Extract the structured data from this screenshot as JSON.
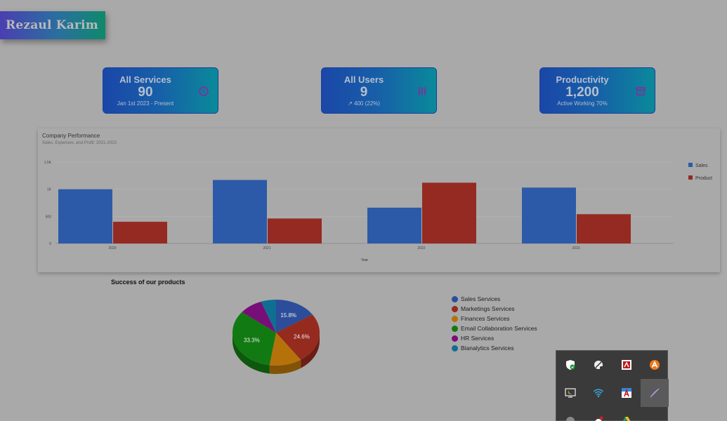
{
  "brand": {
    "name": "Rezaul Karim"
  },
  "cards": [
    {
      "title": "All Services",
      "value": "90",
      "sub": "Jan 1st 2023 - Present",
      "icon": "clock-icon"
    },
    {
      "title": "All Users",
      "value": "9",
      "sub": "↗ 400 (22%)",
      "icon": "sliders-icon"
    },
    {
      "title": "Productivity",
      "value": "1,200",
      "sub": "Active Working 70%",
      "icon": "archive-icon"
    }
  ],
  "performance": {
    "title": "Company Performance",
    "subtitle": "Sales, Expenses, and Profit: 2021-2023"
  },
  "pie_section": {
    "title": "Success of our products"
  },
  "chart_data": [
    {
      "type": "bar",
      "title": "Company Performance",
      "subtitle": "Sales, Expenses, and Profit: 2021-2023",
      "categories": [
        "2020",
        "2021",
        "2022",
        "2023"
      ],
      "series": [
        {
          "name": "Sales",
          "values": [
            1000,
            1170,
            660,
            1030
          ],
          "color": "#2c5aa8"
        },
        {
          "name": "Product",
          "values": [
            400,
            460,
            1120,
            540
          ],
          "color": "#952a22"
        }
      ],
      "xlabel": "Year",
      "ylabel": "",
      "ylim": [
        0,
        1500
      ],
      "yticks": [
        "0",
        "500",
        "1K",
        "1.5K"
      ],
      "legend": "right",
      "grid": true
    },
    {
      "type": "pie",
      "title": "Success of our products",
      "slices": [
        {
          "label": "Sales Services",
          "value": 15.8,
          "color": "#2c4d9a",
          "shown": "15.8%"
        },
        {
          "label": "Marketings Services",
          "value": 24.6,
          "color": "#952a1e",
          "shown": "24.6%"
        },
        {
          "label": "Finances Services",
          "value": 12.0,
          "color": "#b5720a",
          "shown": ""
        },
        {
          "label": "Email Collaboration Services",
          "value": 33.3,
          "color": "#127a12",
          "shown": "33.3%"
        },
        {
          "label": "HR Services",
          "value": 8.7,
          "color": "#780f78",
          "shown": ""
        },
        {
          "label": "Bianalytics Services",
          "value": 5.6,
          "color": "#0f6f92",
          "shown": ""
        }
      ],
      "legend": "right"
    }
  ],
  "tray": {
    "icons": [
      "shield-check-icon",
      "satellite-dish-icon",
      "pdf-app-icon",
      "avast-icon",
      "night-light-icon",
      "wifi-icon",
      "font-app-icon",
      "feather-pen-icon",
      "grey-app-icon",
      "chat-bot-icon",
      "google-drive-icon"
    ]
  }
}
